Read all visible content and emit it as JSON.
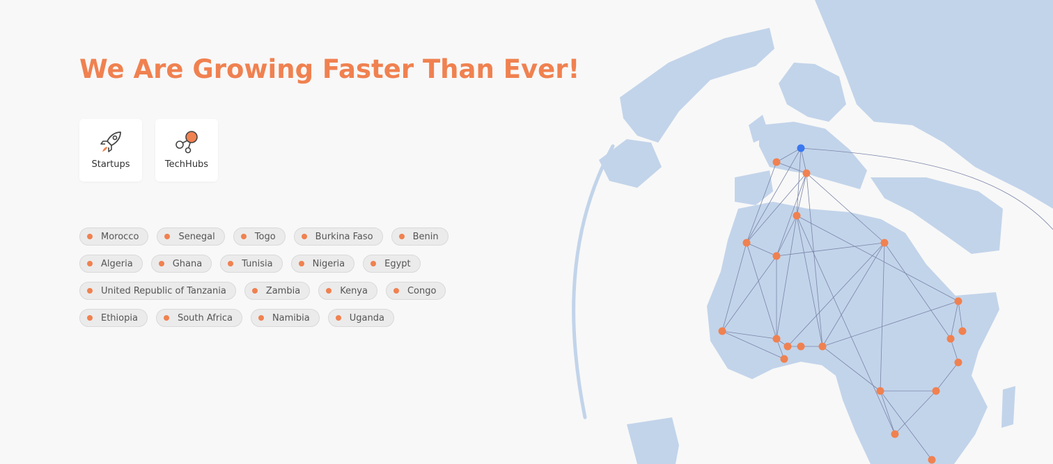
{
  "header": {
    "title": "We Are Growing Faster Than Ever!"
  },
  "categories": [
    {
      "label": "Startups",
      "icon": "rocket-icon"
    },
    {
      "label": "TechHubs",
      "icon": "network-nodes-icon"
    }
  ],
  "countries": [
    [
      "Morocco",
      "Senegal",
      "Togo",
      "Burkina Faso",
      "Benin"
    ],
    [
      "Algeria",
      "Ghana",
      "Tunisia",
      "Nigeria",
      "Egypt"
    ],
    [
      "United Republic of Tanzania",
      "Zambia",
      "Kenya",
      "Congo"
    ],
    [
      "Ethiopia",
      "South Africa",
      "Namibia",
      "Uganda"
    ]
  ],
  "colors": {
    "accent": "#f08150",
    "land": "#c2d4ea",
    "hub": "#3b78f0",
    "link": "#7a84a8",
    "background": "#f8f8f8"
  }
}
